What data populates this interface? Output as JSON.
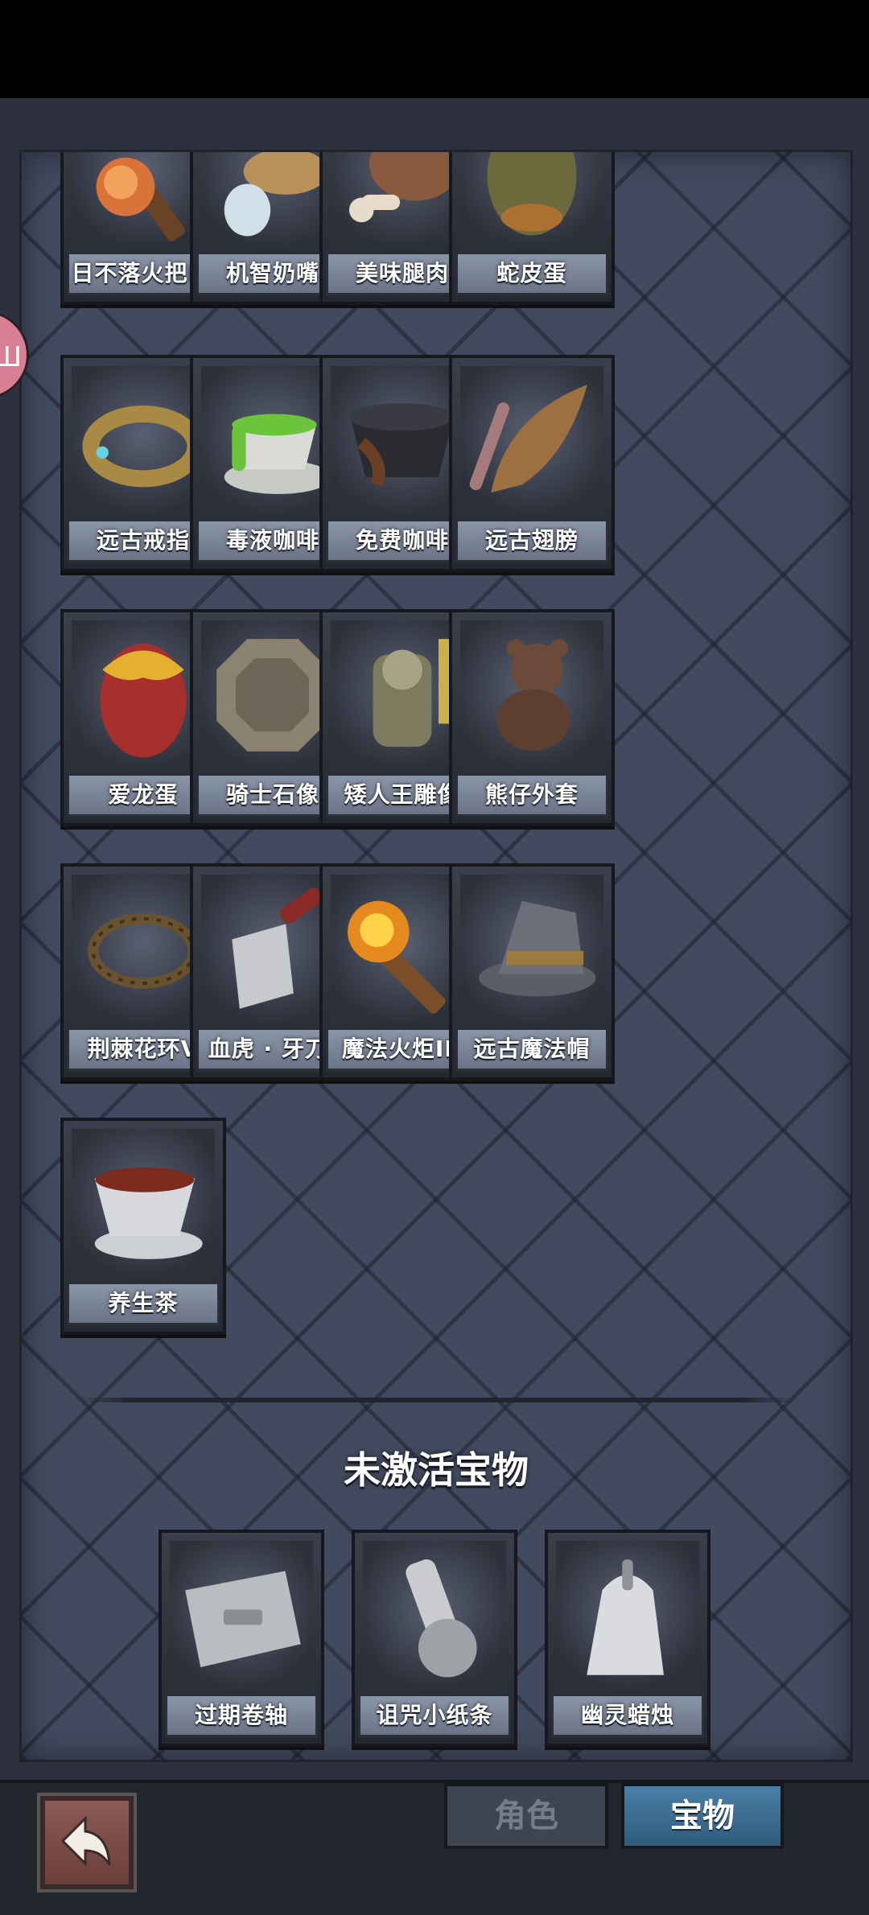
{
  "side_float_text": "Ш",
  "active_items": [
    {
      "name": "日不落火把IV",
      "icon": "torch-icon"
    },
    {
      "name": "机智奶嘴",
      "icon": "pacifier-icon"
    },
    {
      "name": "美味腿肉",
      "icon": "drumstick-icon"
    },
    {
      "name": "蛇皮蛋",
      "icon": "snake-egg-icon"
    },
    {
      "name": "远古戒指",
      "icon": "ring-icon"
    },
    {
      "name": "毒液咖啡",
      "icon": "poison-coffee-icon"
    },
    {
      "name": "免费咖啡",
      "icon": "coffee-cup-icon"
    },
    {
      "name": "远古翅膀",
      "icon": "wing-icon"
    },
    {
      "name": "爱龙蛋",
      "icon": "dragon-egg-icon"
    },
    {
      "name": "骑士石像",
      "icon": "knight-statue-icon"
    },
    {
      "name": "矮人王雕像",
      "icon": "dwarf-king-statue-icon"
    },
    {
      "name": "熊仔外套",
      "icon": "teddy-bear-icon"
    },
    {
      "name": "荆棘花环V",
      "icon": "thorn-wreath-icon"
    },
    {
      "name": "血虎 · 牙刀I",
      "icon": "cleaver-icon"
    },
    {
      "name": "魔法火炬III",
      "icon": "magic-torch-icon"
    },
    {
      "name": "远古魔法帽",
      "icon": "wizard-hat-icon"
    },
    {
      "name": "养生茶",
      "icon": "tea-cup-icon"
    }
  ],
  "inactive_section_title": "未激活宝物",
  "inactive_items": [
    {
      "name": "过期卷轴",
      "icon": "scroll-icon"
    },
    {
      "name": "诅咒小纸条",
      "icon": "paper-note-icon"
    },
    {
      "name": "幽灵蜡烛",
      "icon": "ghost-candle-icon"
    }
  ],
  "tabs": {
    "role": "角色",
    "treasure": "宝物"
  },
  "colors": {
    "panel": "#424a5f",
    "label": "#7f899c",
    "active_tab": "#3d6c91"
  }
}
